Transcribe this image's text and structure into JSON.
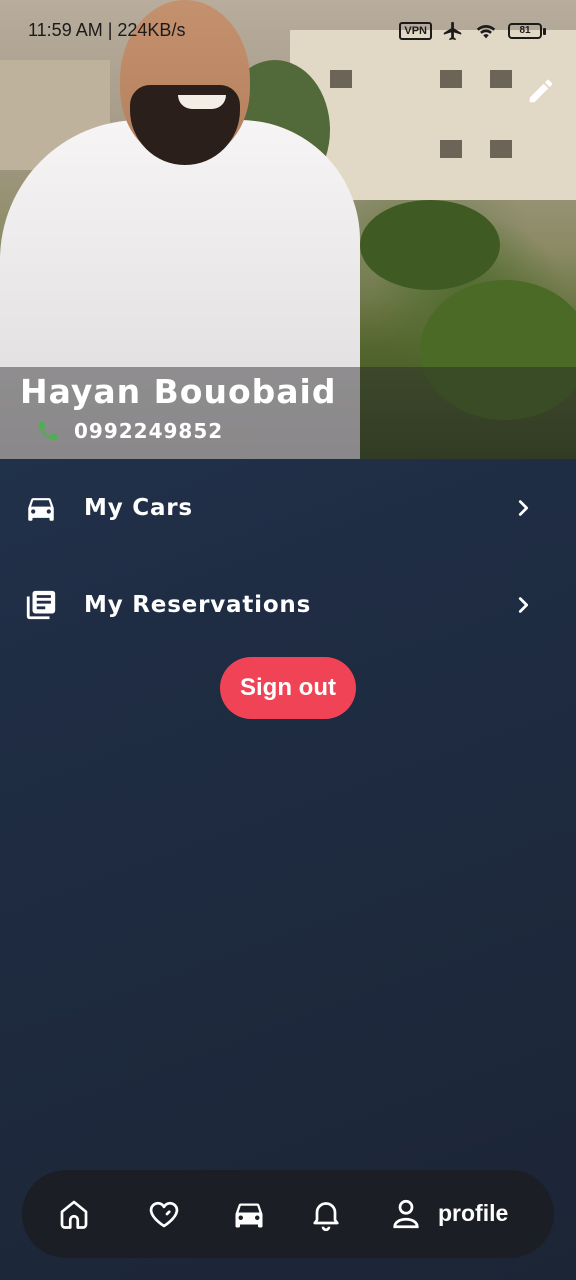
{
  "status_bar": {
    "time": "11:59 AM | 224KB/s",
    "vpn": "VPN",
    "battery": "81"
  },
  "profile": {
    "name": "Hayan Bouobaid",
    "phone": "0992249852"
  },
  "menu": {
    "items": [
      {
        "label": "My Cars",
        "icon": "car-icon"
      },
      {
        "label": "My Reservations",
        "icon": "reservations-icon"
      }
    ]
  },
  "actions": {
    "sign_out_label": "Sign out"
  },
  "bottom_nav": {
    "items": [
      {
        "icon": "home-icon"
      },
      {
        "icon": "heart-icon"
      },
      {
        "icon": "car-icon"
      },
      {
        "icon": "bell-icon"
      },
      {
        "icon": "profile-icon",
        "label": "profile",
        "active": true
      }
    ]
  },
  "colors": {
    "background": "#1f2d44",
    "accent_red": "#f04355",
    "phone_green": "#4caf50",
    "nav_bg": "#1b1e24"
  }
}
